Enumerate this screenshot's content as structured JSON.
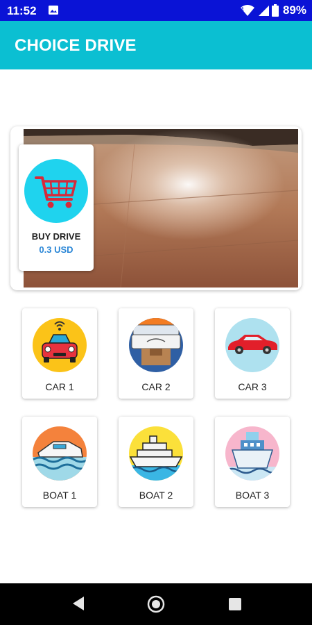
{
  "status_bar": {
    "time": "11:52",
    "battery": "89%",
    "icons": [
      "image-icon",
      "wifi-icon",
      "signal-icon",
      "battery-icon"
    ]
  },
  "app_bar": {
    "title": "CHOICE DRIVE"
  },
  "hero": {
    "buy_title": "BUY DRIVE",
    "buy_price": "0.3 USD",
    "buy_icon": "shopping-cart-icon"
  },
  "vehicles": [
    {
      "label": "CAR 1",
      "icon": "car-1-icon"
    },
    {
      "label": "CAR 2",
      "icon": "car-2-icon"
    },
    {
      "label": "CAR 3",
      "icon": "car-3-icon"
    },
    {
      "label": "BOAT 1",
      "icon": "boat-1-icon"
    },
    {
      "label": "BOAT 2",
      "icon": "boat-2-icon"
    },
    {
      "label": "BOAT 3",
      "icon": "boat-3-icon"
    }
  ],
  "colors": {
    "status_bar": "#0a13d6",
    "app_bar": "#0bbfd2",
    "price": "#2a86d6",
    "cart_circle": "#1fd3ee",
    "cart_red": "#e5252c"
  }
}
